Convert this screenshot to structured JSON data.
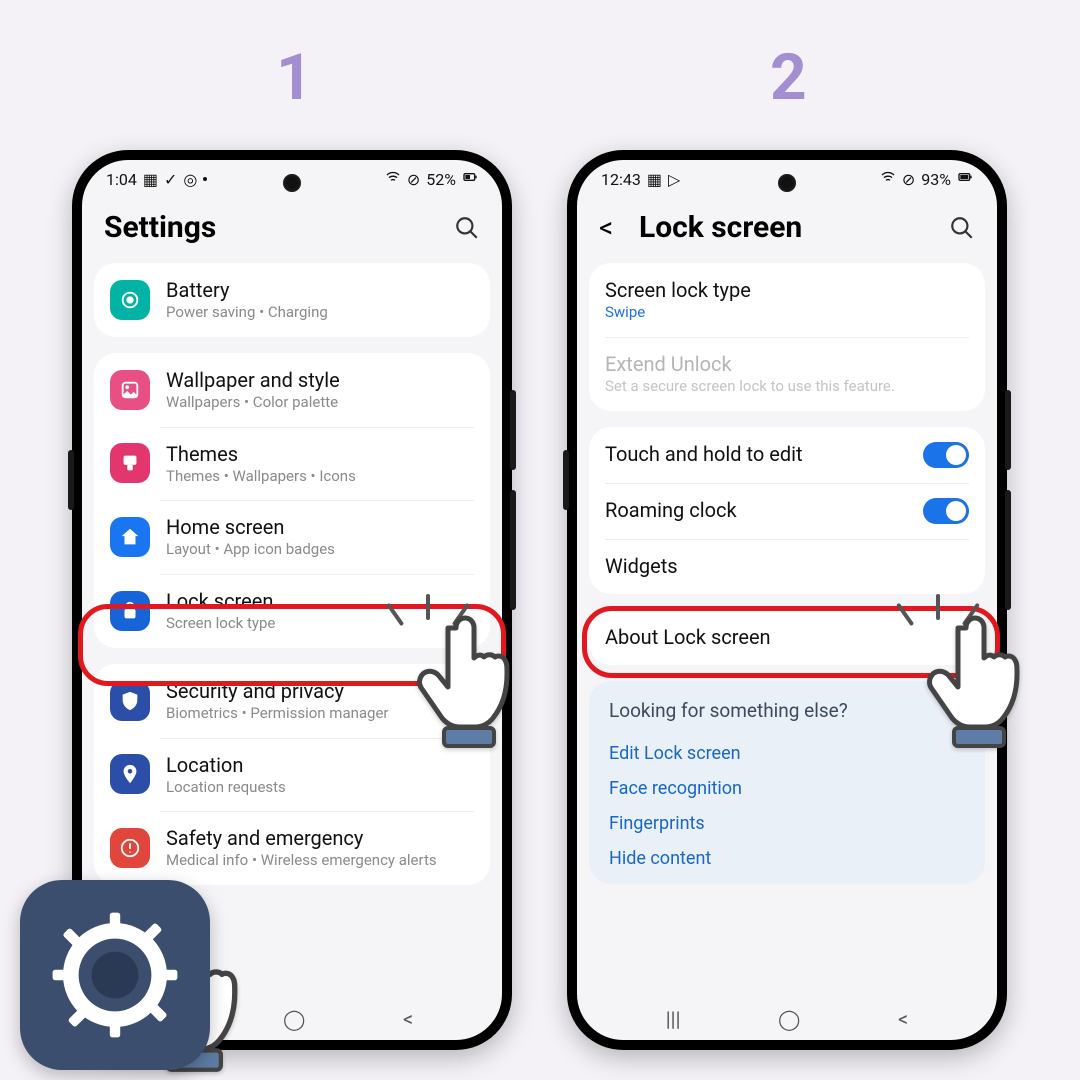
{
  "steps": {
    "one": "1",
    "two": "2"
  },
  "phone1": {
    "status": {
      "time": "1:04",
      "battery": "52%"
    },
    "header": {
      "title": "Settings"
    },
    "groups": [
      [
        {
          "title": "Battery",
          "sub": "Power saving  •  Charging",
          "icon": "battery",
          "color": "ic-teal"
        }
      ],
      [
        {
          "title": "Wallpaper and style",
          "sub": "Wallpapers  •  Color palette",
          "icon": "image",
          "color": "ic-pink"
        },
        {
          "title": "Themes",
          "sub": "Themes  •  Wallpapers  •  Icons",
          "icon": "brush",
          "color": "ic-pink2"
        },
        {
          "title": "Home screen",
          "sub": "Layout  •  App icon badges",
          "icon": "home",
          "color": "ic-blue"
        },
        {
          "title": "Lock screen",
          "sub": "Screen lock type",
          "icon": "lock",
          "color": "ic-blue2",
          "highlight": true
        }
      ],
      [
        {
          "title": "Security and privacy",
          "sub": "Biometrics  •  Permission manager",
          "icon": "shield",
          "color": "ic-navy"
        },
        {
          "title": "Location",
          "sub": "Location requests",
          "icon": "pin",
          "color": "ic-navy"
        },
        {
          "title": "Safety and emergency",
          "sub": "Medical info  •  Wireless emergency alerts",
          "icon": "sos",
          "color": "ic-red"
        }
      ]
    ]
  },
  "phone2": {
    "status": {
      "time": "12:43",
      "battery": "93%"
    },
    "header": {
      "title": "Lock screen"
    },
    "group1": {
      "row1": {
        "title": "Screen lock type",
        "sub": "Swipe"
      },
      "row2": {
        "title": "Extend Unlock",
        "sub": "Set a secure screen lock to use this feature."
      }
    },
    "group2": {
      "row1": {
        "title": "Touch and hold to edit"
      },
      "row2": {
        "title": "Roaming clock"
      },
      "row3": {
        "title": "Widgets"
      }
    },
    "group3": {
      "row1": {
        "title": "About Lock screen"
      }
    },
    "info": {
      "title": "Looking for something else?",
      "links": [
        "Edit Lock screen",
        "Face recognition",
        "Fingerprints",
        "Hide content"
      ]
    }
  }
}
